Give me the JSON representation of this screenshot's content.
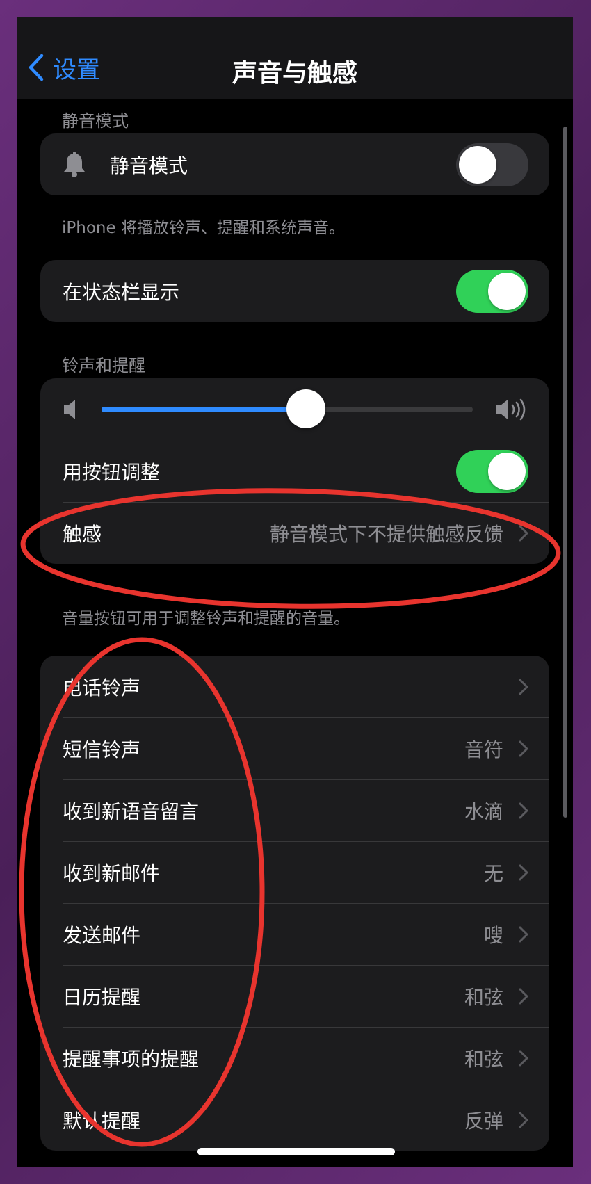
{
  "navbar": {
    "back_label": "设置",
    "title": "声音与触感"
  },
  "silent_section": {
    "header": "静音模式",
    "row_label": "静音模式",
    "toggle_on": false,
    "footnote": "iPhone 将播放铃声、提醒和系统声音。"
  },
  "status_bar_row": {
    "label": "在状态栏显示",
    "toggle_on": true
  },
  "ringer_section": {
    "header": "铃声和提醒",
    "volume_level": 0.55,
    "adjust_row": {
      "label": "用按钮调整",
      "toggle_on": true
    },
    "haptics_row": {
      "label": "触感",
      "value": "静音模式下不提供触感反馈"
    },
    "footnote": "音量按钮可用于调整铃声和提醒的音量。"
  },
  "sounds_list": [
    {
      "label": "电话铃声",
      "value": ""
    },
    {
      "label": "短信铃声",
      "value": "音符"
    },
    {
      "label": "收到新语音留言",
      "value": "水滴"
    },
    {
      "label": "收到新邮件",
      "value": "无"
    },
    {
      "label": "发送邮件",
      "value": "嗖"
    },
    {
      "label": "日历提醒",
      "value": "和弦"
    },
    {
      "label": "提醒事项的提醒",
      "value": "和弦"
    },
    {
      "label": "默认提醒",
      "value": "反弹"
    }
  ],
  "colors": {
    "accent": "#2f8bff",
    "toggle_on": "#30d158",
    "annotation": "#e8342e"
  }
}
